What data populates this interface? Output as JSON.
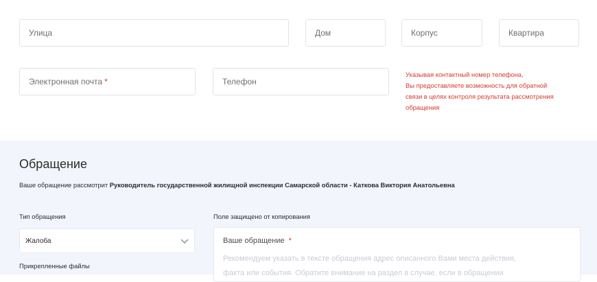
{
  "address": {
    "street_placeholder": "Улица",
    "house_placeholder": "Дом",
    "building_placeholder": "Корпус",
    "apartment_placeholder": "Квартира"
  },
  "contacts": {
    "email_placeholder": "Электронная почта",
    "required_mark": "*",
    "phone_placeholder": "Телефон",
    "phone_hint_lines": [
      "Указывая контактный номер телефона,",
      "Вы предоставляете возможность для обратной",
      "связи в целях контроля результата рассмотрения",
      "обращения"
    ]
  },
  "appeal": {
    "title": "Обращение",
    "reviewer_prefix": "Ваше обращение рассмотрит",
    "reviewer_name": "Руководитель государственной жилищной инспекции Самарской области - Каткова Виктория Анатольевна",
    "type_label": "Тип обращения",
    "type_value": "Жалоба",
    "attachments_label": "Прикрепленные файлы",
    "protected_label": "Поле защищено от копирования",
    "text_label": "Ваше обращение",
    "text_required_mark": "*",
    "text_placeholder_line1": "Рекомендуем указать в тексте обращения адрес описанного Вами места действия,",
    "text_placeholder_line2": "факта или события. Обратите внимание на раздел в случае, если в обращении"
  },
  "colors": {
    "required": "#d9382f",
    "section_bg": "#f2f5fb",
    "border": "#dfe3ea"
  }
}
